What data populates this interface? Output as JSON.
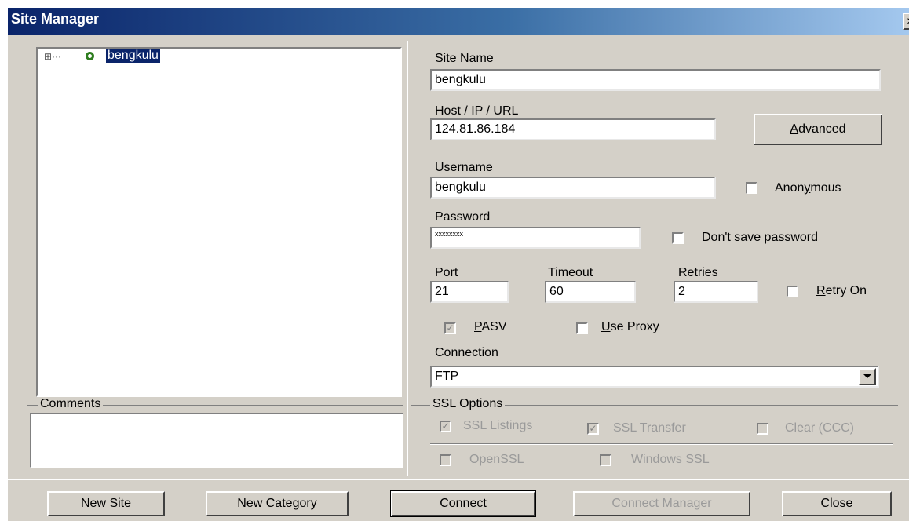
{
  "window": {
    "title": "Site Manager",
    "close_glyph": "×"
  },
  "tree": {
    "expand_glyph": "⊞···",
    "node_icon": "site-node-icon",
    "node_label": "bengkulu"
  },
  "comments": {
    "label": "Comments",
    "value": ""
  },
  "site_name": {
    "label": "Site Name",
    "value": "bengkulu"
  },
  "host": {
    "label": "Host / IP / URL",
    "value": "124.81.86.184"
  },
  "advanced_button": {
    "pre": "",
    "accel": "A",
    "post": "dvanced"
  },
  "username": {
    "label": "Username",
    "value": "bengkulu"
  },
  "anonymous": {
    "pre": "Anon",
    "accel": "y",
    "post": "mous",
    "checked": false
  },
  "password": {
    "label": "Password",
    "value": "xxxxxxxx"
  },
  "dont_save_password": {
    "pre": "Don't save pass",
    "accel": "w",
    "post": "ord",
    "checked": false
  },
  "port": {
    "label": "Port",
    "value": "21"
  },
  "timeout": {
    "label": "Timeout",
    "value": "60"
  },
  "retries": {
    "label": "Retries",
    "value": "2"
  },
  "retry_on": {
    "pre": "",
    "accel": "R",
    "post": "etry On",
    "checked": false
  },
  "pasv": {
    "pre": "",
    "accel": "P",
    "post": "ASV",
    "checked": true,
    "check_glyph": "✓"
  },
  "use_proxy": {
    "pre": "",
    "accel": "U",
    "post": "se Proxy",
    "checked": false
  },
  "connection": {
    "label": "Connection",
    "value": "FTP"
  },
  "ssl": {
    "label": "SSL Options",
    "ssl_listings": "SSL Listings",
    "ssl_transfer": "SSL Transfer",
    "clear_ccc": "Clear (CCC)",
    "openssl": "OpenSSL",
    "windows_ssl": "Windows SSL",
    "check_glyph": "✓"
  },
  "buttons": {
    "new_site": {
      "pre": "",
      "accel": "N",
      "post": "ew Site"
    },
    "new_category": {
      "pre": "New Cat",
      "accel": "e",
      "post": "gory"
    },
    "connect": {
      "pre": "C",
      "accel": "o",
      "post": "nnect"
    },
    "connect_manager": {
      "pre": "Connect ",
      "accel": "M",
      "post": "anager"
    },
    "close": {
      "pre": "",
      "accel": "C",
      "post": "lose"
    }
  }
}
